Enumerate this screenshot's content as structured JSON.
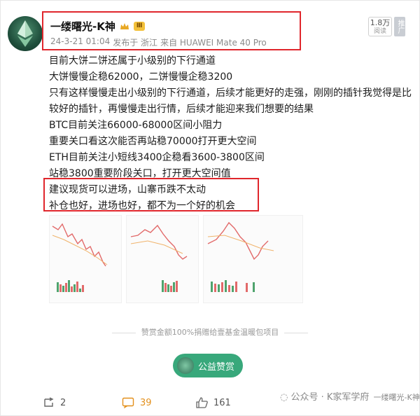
{
  "post": {
    "author": "一缕曙光-K神",
    "level": "Ⅲ",
    "timestamp": "24-3-21 01:04",
    "location": "发布于 浙江",
    "device": "来自 HUAWEI Mate 40 Pro",
    "follower_count": "1.8万",
    "follower_label": "阅读",
    "recommend_label": "推广",
    "lines": [
      "目前大饼二饼还属于小级别的下行通道",
      "大饼慢慢企稳62000，二饼慢慢企稳3200",
      "只有这样慢慢走出小级别的下行通道，后续才能更好的走强，刚刚的插针我觉得是比较好的插针，再慢慢走出行情，后续才能迎来我们想要的结果",
      "BTC目前关注66000-68000区间小阻力",
      "重要关口看这次能否再站稳70000打开更大空间",
      "ETH目前关注小短线3400企稳看3600-3800区间",
      "站稳3800重要阶段关口，打开更大空间值",
      "建议现货可以进场，山寨币跌不太动",
      "补仓也好，进场也好，都不为一个好的机会"
    ],
    "donation_notice": "赞赏金额100%捐赠给壹基金温暖包项目",
    "donate_button": "公益赞赏"
  },
  "actions": {
    "repost_count": "2",
    "comment_count": "39",
    "like_count": "161"
  },
  "watermark": "公众号 · K家军学府",
  "watermark_sub": "一缕曙光-K神",
  "colors": {
    "highlight_red": "#e0262c",
    "donate_green": "#38a87b",
    "comment_orange": "#e3901c",
    "link_blue": "#3a6fbf"
  }
}
